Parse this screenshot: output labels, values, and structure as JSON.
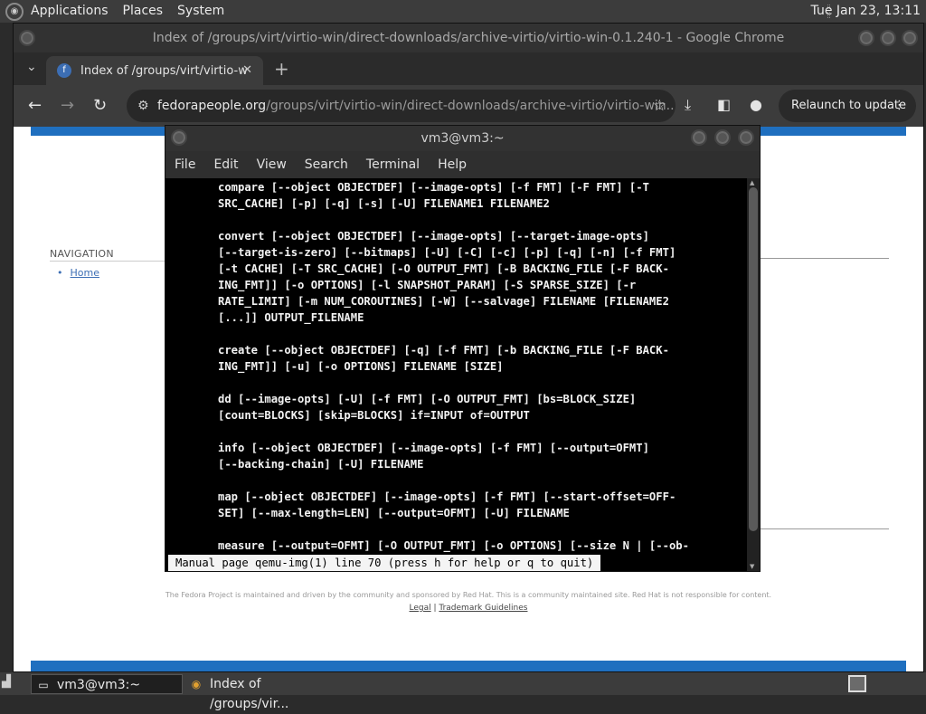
{
  "top_panel": {
    "menus": [
      "Applications",
      "Places",
      "System"
    ],
    "clock": "Tue Jan 23, 13:11"
  },
  "chrome": {
    "window_title": "Index of /groups/virt/virtio-win/direct-downloads/archive-virtio/virtio-win-0.1.240-1 - Google Chrome",
    "tab_title": "Index of /groups/virt/virtio-w",
    "url_host": "fedorapeople.org",
    "url_path": "/groups/virt/virtio-win/direct-downloads/archive-virtio/virtio-win...",
    "relaunch_label": "Relaunch to update"
  },
  "webpage": {
    "nav_heading": "NAVIGATION",
    "nav_home": "Home",
    "footer_text": "The Fedora Project is maintained and driven by the community and sponsored by Red Hat. This is a community maintained site. Red Hat is not responsible for content.",
    "footer_link_legal": "Legal",
    "footer_link_trademark": "Trademark Guidelines"
  },
  "terminal": {
    "window_title": "vm3@vm3:~",
    "menu": [
      "File",
      "Edit",
      "View",
      "Search",
      "Terminal",
      "Help"
    ],
    "lines": [
      "compare [--object OBJECTDEF] [--image-opts] [-f FMT] [-F FMT] [-T",
      "SRC_CACHE] [-p] [-q] [-s] [-U] FILENAME1 FILENAME2",
      "",
      "convert [--object OBJECTDEF] [--image-opts] [--target-image-opts]",
      "[--target-is-zero] [--bitmaps] [-U] [-C] [-c] [-p] [-q] [-n] [-f FMT]",
      "[-t CACHE] [-T SRC_CACHE] [-O OUTPUT_FMT] [-B BACKING_FILE [-F BACK-",
      "ING_FMT]] [-o OPTIONS] [-l SNAPSHOT_PARAM] [-S SPARSE_SIZE] [-r",
      "RATE_LIMIT] [-m NUM_COROUTINES] [-W] [--salvage] FILENAME [FILENAME2",
      "[...]] OUTPUT_FILENAME",
      "",
      "create [--object OBJECTDEF] [-q] [-f FMT] [-b BACKING_FILE [-F BACK-",
      "ING_FMT]] [-u] [-o OPTIONS] FILENAME [SIZE]",
      "",
      "dd [--image-opts] [-U] [-f FMT] [-O OUTPUT_FMT] [bs=BLOCK_SIZE]",
      "[count=BLOCKS] [skip=BLOCKS] if=INPUT of=OUTPUT",
      "",
      "info [--object OBJECTDEF] [--image-opts] [-f FMT] [--output=OFMT]",
      "[--backing-chain] [-U] FILENAME",
      "",
      "map [--object OBJECTDEF] [--image-opts] [-f FMT] [--start-offset=OFF-",
      "SET] [--max-length=LEN] [--output=OFMT] [-U] FILENAME",
      "",
      "measure [--output=OFMT] [-O OUTPUT_FMT] [-o OPTIONS] [--size N | [--ob-"
    ],
    "status_line": "Manual page qemu-img(1) line 70 (press h for help or q to quit)"
  },
  "taskbar": {
    "items": [
      "vm3@vm3:~",
      "Index of /groups/vir..."
    ]
  }
}
